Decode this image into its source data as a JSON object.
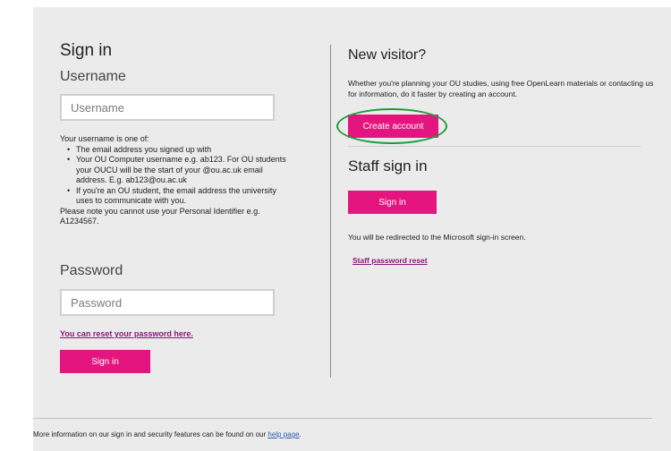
{
  "signin": {
    "heading": "Sign in",
    "username_label": "Username",
    "username_placeholder": "Username",
    "username_value": "",
    "help_intro": "Your username is one of:",
    "help_items": [
      "The email address you signed up with",
      "Your OU Computer username e.g. ab123. For OU students your OUCU will be the start of your @ou.ac.uk email address. E.g. ab123@ou.ac.uk",
      "If you're an OU student, the email address the university uses to communicate with you."
    ],
    "help_note": "Please note you cannot use your Personal Identifier e.g. A1234567.",
    "password_label": "Password",
    "password_placeholder": "Password",
    "password_value": "",
    "reset_link": "You can reset your password here",
    "reset_suffix": ".",
    "button_label": "Sign in"
  },
  "new_visitor": {
    "heading": "New visitor?",
    "description": "Whether you're planning your OU studies, using free OpenLearn materials or contacting us for information, do it faster by creating an account.",
    "button_label": "Create account"
  },
  "staff": {
    "heading": "Staff sign in",
    "button_label": "Sign in",
    "redirect_note": "You will be redirected to the Microsoft sign-in screen.",
    "reset_link": "Staff password reset"
  },
  "footer": {
    "text": "More information on our sign in and security features can be found on our ",
    "link": "help page",
    "suffix": "."
  },
  "colors": {
    "accent": "#e4157e",
    "link": "#8a1a7a",
    "highlight": "#1f9a3c",
    "panel_bg": "#ebebeb"
  }
}
